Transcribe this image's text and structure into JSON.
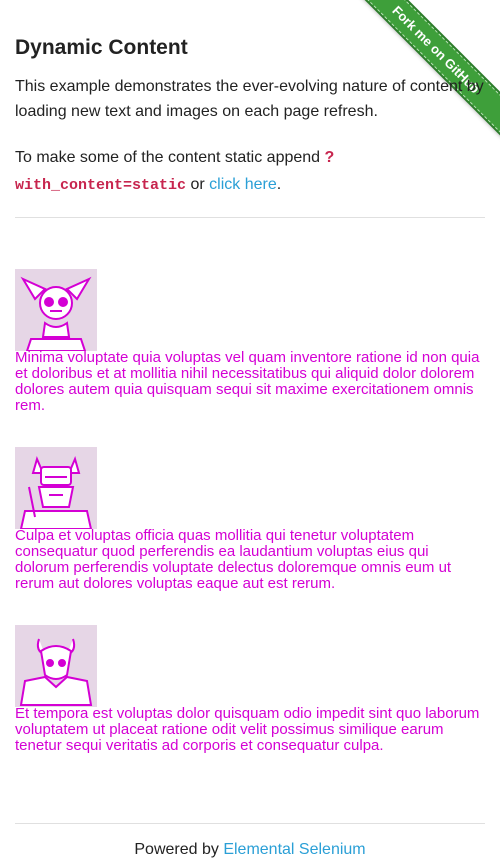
{
  "ribbon": {
    "label": "Fork me on GitHub",
    "color": "#3e9f3a"
  },
  "page": {
    "title": "Dynamic Content",
    "description": "This example demonstrates the ever-evolving nature of content by loading new text and images on each page refresh.",
    "static_prefix": "To make some of the content static append",
    "static_qmark": "?",
    "static_code": "with_content=static",
    "static_or": "or",
    "static_link": "click here",
    "static_period": "."
  },
  "rows": [
    {
      "avatar_icon": "skull-jester-avatar-icon",
      "text": "Minima voluptate quia voluptas vel quam inventore ratione id non quia et doloribus et at mollitia nihil necessitatibus qui aliquid dolor dolorem dolores autem quia quisquam sequi sit maxime exercitationem omnis rem."
    },
    {
      "avatar_icon": "viking-warrior-avatar-icon",
      "text": "Culpa et voluptas officia quas mollitia qui tenetur voluptatem consequatur quod perferendis ea laudantium voluptas eius qui dolorum perferendis voluptate delectus doloremque omnis eum ut rerum aut dolores voluptas eaque aut est rerum."
    },
    {
      "avatar_icon": "horned-mage-avatar-icon",
      "text": "Et tempora est voluptas dolor quisquam odio impedit sint quo laborum voluptatem ut placeat ratione odit velit possimus similique earum tenetur sequi veritatis ad corporis et consequatur culpa."
    }
  ],
  "footer": {
    "prefix": "Powered by",
    "link": "Elemental Selenium"
  },
  "colors": {
    "accent": "#d400d4",
    "link": "#2a9fd6",
    "code": "#c7254e"
  }
}
